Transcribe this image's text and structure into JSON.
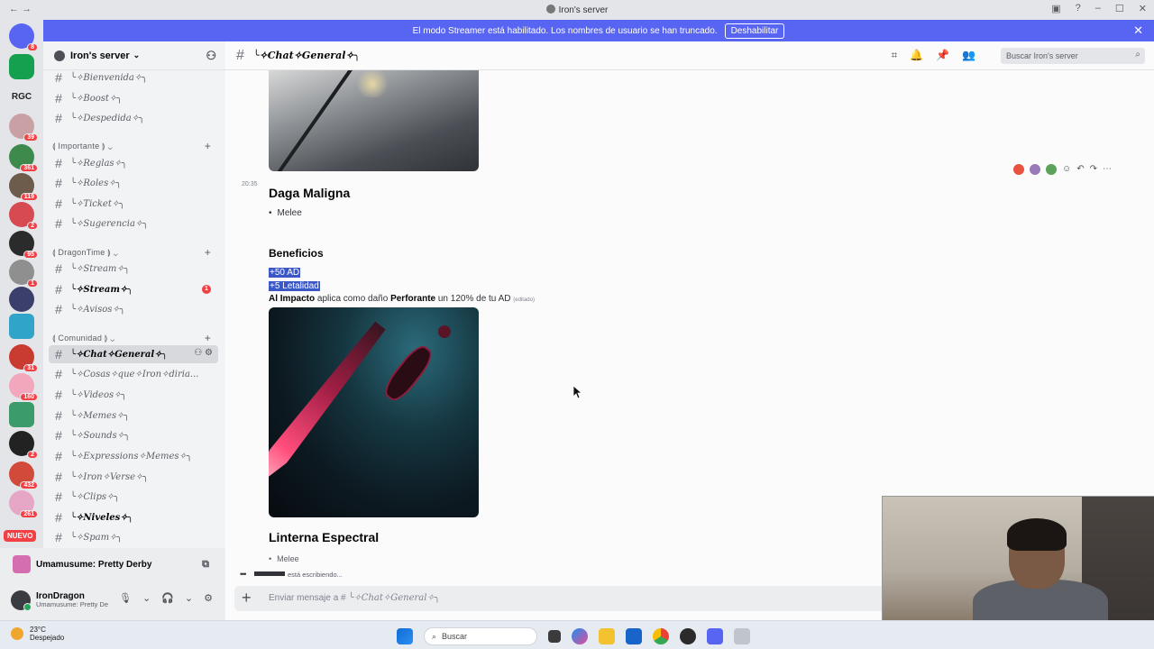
{
  "window": {
    "title": "Iron's server"
  },
  "banner": {
    "text": "El modo Streamer está habilitado. Los nombres de usuario se han truncado.",
    "button": "Deshabilitar"
  },
  "guilds": {
    "text_server": "RGC",
    "badges": [
      "8",
      "39",
      "361",
      "119",
      "2",
      "95",
      "1",
      "31",
      "160",
      "2",
      "432",
      "261"
    ],
    "new_label": "NUEVO"
  },
  "server": {
    "name": "Iron's server"
  },
  "channels": {
    "top": [
      "╰✧Bienvenida✧╮",
      "╰✧Boost✧╮",
      "╰✧Despedida✧╮"
    ],
    "cat_importante": "⟬ Importante ⟭",
    "importante": [
      "╰✧Reglas✧╮",
      "╰✧Roles✧╮",
      "╰✧Ticket✧╮",
      "╰✧Sugerencia✧╮"
    ],
    "cat_dragon": "⟬ DragonTime ⟭",
    "dragon": [
      "╰✧Stream✧╮",
      "╰✧Stream✧╮",
      "╰✧Avisos✧╮"
    ],
    "dragon_badge": "1",
    "cat_comunidad": "⟬ Comunidad ⟭",
    "comunidad": [
      "╰✧Chat✧General✧╮",
      "╰✧Cosas✧que✧Iron✧diria...",
      "╰✧Videos✧╮",
      "╰✧Memes✧╮",
      "╰✧Sounds✧╮",
      "╰✧Expressions✧Memes✧╮",
      "╰✧Iron✧Verse✧╮",
      "╰✧Clips✧╮",
      "╰✧Niveles✧╮",
      "╰✧Spam✧╮"
    ]
  },
  "activity": {
    "label": "Umamusume: Pretty Derby"
  },
  "user": {
    "name": "IronDragon",
    "status": "Umamusume: Pretty De"
  },
  "header": {
    "channel": "╰✧Chat✧General✧╮",
    "search_placeholder": "Buscar Iron's server"
  },
  "message": {
    "time": "20:35",
    "title": "Daga Maligna",
    "bullet": "Melee",
    "benefits_title": "Beneficios",
    "stat1": "+50 AD",
    "stat2": "+5 Letalidad",
    "impact_bold": "Al Impacto",
    "impact_mid": " aplica como daño ",
    "impact_bold2": "Perforante",
    "impact_end": " un 120% de tu AD ",
    "edited": "(editado)",
    "next_title": "Linterna Espectral",
    "next_bullet": "Melee"
  },
  "typing": {
    "text": "está escribiendo..."
  },
  "composer": {
    "placeholder_prefix": "Enviar mensaje a # ",
    "placeholder_channel": "╰✧Chat✧General✧╮"
  },
  "taskbar": {
    "temp": "23°C",
    "weather": "Despejado",
    "search": "Buscar"
  },
  "colors": {
    "accent": "#5865f2",
    "danger": "#f23f43",
    "highlight": "#3b57c7"
  }
}
